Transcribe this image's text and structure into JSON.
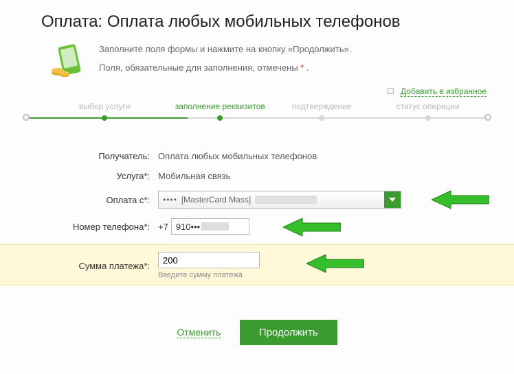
{
  "page_title": "Оплата: Оплата любых мобильных телефонов",
  "intro": {
    "line1": "Заполните поля формы и нажмите на кнопку «Продолжить».",
    "line2_prefix": "Поля, обязательные для заполнения, отмечены ",
    "line2_marker": "*",
    "line2_suffix": " ."
  },
  "favorites": {
    "label": "Добавить в избранное"
  },
  "stepper": {
    "steps": [
      {
        "label": "выбор услуги",
        "active": false
      },
      {
        "label": "заполнение реквизитов",
        "active": true
      },
      {
        "label": "подтверждение",
        "active": false
      },
      {
        "label": "статус операции",
        "active": false
      }
    ]
  },
  "form": {
    "recipient": {
      "label": "Получатель:",
      "value": "Оплата любых мобильных телефонов"
    },
    "service": {
      "label": "Услуга*:",
      "value": "Мобильная связь"
    },
    "pay_from": {
      "label": "Оплата с*:",
      "card_text": "[MasterCard Mass]",
      "dots": "•••• "
    },
    "phone": {
      "label": "Номер телефона*:",
      "prefix": "+7",
      "value_part": "910•••"
    },
    "amount": {
      "label": "Сумма платежа*:",
      "value": "200",
      "hint": "Введите сумму платежа"
    }
  },
  "actions": {
    "cancel": "Отменить",
    "continue": "Продолжить"
  },
  "colors": {
    "accent": "#3a9b2e",
    "highlight_bg": "#fff9d9"
  }
}
